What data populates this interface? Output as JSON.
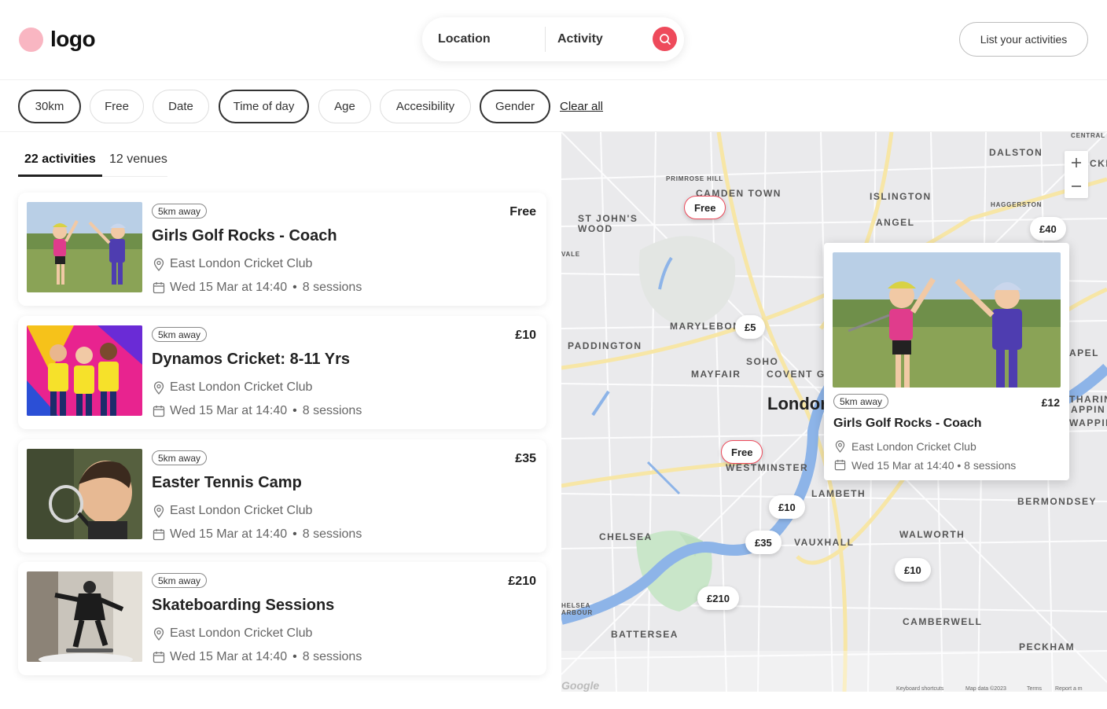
{
  "header": {
    "logo_text": "logo",
    "search": {
      "location": "Location",
      "activity": "Activity"
    },
    "list_button": "List your activities"
  },
  "filters": {
    "chips": [
      {
        "label": "30km",
        "active": true
      },
      {
        "label": "Free",
        "active": false
      },
      {
        "label": "Date",
        "active": false
      },
      {
        "label": "Time of day",
        "active": true
      },
      {
        "label": "Age",
        "active": false
      },
      {
        "label": "Accesibility",
        "active": false
      },
      {
        "label": "Gender",
        "active": true
      }
    ],
    "clear_all": "Clear all"
  },
  "tabs": [
    {
      "label": "22 activities",
      "selected": true
    },
    {
      "label": "12 venues",
      "selected": false
    }
  ],
  "activities": [
    {
      "title": "Girls Golf Rocks - Coach",
      "price": "Free",
      "distance": "5km away",
      "venue": "East London Cricket Club",
      "date": "Wed 15 Mar at 14:40",
      "sessions": "8 sessions"
    },
    {
      "title": "Dynamos Cricket: 8-11 Yrs",
      "price": "£10",
      "distance": "5km away",
      "venue": "East London Cricket Club",
      "date": "Wed 15 Mar at 14:40",
      "sessions": "8 sessions"
    },
    {
      "title": "Easter Tennis Camp",
      "price": "£35",
      "distance": "5km away",
      "venue": "East London Cricket Club",
      "date": "Wed 15 Mar at 14:40",
      "sessions": "8 sessions"
    },
    {
      "title": "Skateboarding Sessions",
      "price": "£210",
      "distance": "5km away",
      "venue": "East London Cricket Club",
      "date": "Wed 15 Mar at 14:40",
      "sessions": "8 sessions"
    }
  ],
  "map": {
    "labels": {
      "central": "CENTRAL",
      "dalston": "DALSTON",
      "primrose_hill": "PRIMROSE HILL",
      "camden_town": "CAMDEN TOWN",
      "islington": "ISLINGTON",
      "haggerston": "HAGGERSTON",
      "st_johns_wood": "ST JOHN'S WOOD",
      "angel": "ANGEL",
      "vale": "VALE",
      "marylebone": "MARYLEBON",
      "paddington": "PADDINGTON",
      "soho": "SOHO",
      "mayfair": "MAYFAIR",
      "covent_garden": "COVENT GA",
      "london": "Londor",
      "westminster": "WESTMINSTER",
      "lambeth": "LAMBETH",
      "bermondsey": "BERMONDSEY",
      "chelsea": "CHELSEA",
      "vauxhall": "VAUXHALL",
      "walworth": "WALWORTH",
      "chelsea_harbour": "HELSEA ARBOUR",
      "battersea": "BATTERSEA",
      "camberwell": "CAMBERWELL",
      "peckham": "PECKHAM",
      "cut_ckn": "CKN",
      "cut_apel": "APEL",
      "cut_tharin": "THARIN",
      "cut_appin": "APPIN",
      "cut_wappin": "WAPPIN"
    },
    "pins": {
      "free1": "Free",
      "free2": "Free",
      "p40": "£40",
      "p5": "£5",
      "p10a": "£10",
      "p35": "£35",
      "p210": "£210",
      "p10b": "£10"
    },
    "footer": {
      "google": "Google",
      "shortcuts": "Keyboard shortcuts",
      "mapdata": "Map data ©2023",
      "terms": "Terms",
      "report": "Report a m"
    },
    "popup": {
      "distance": "5km away",
      "price": "£12",
      "title": "Girls Golf Rocks - Coach",
      "venue": "East London Cricket Club",
      "date_sessions": "Wed 15 Mar at 14:40 • 8 sessions"
    }
  },
  "colors": {
    "accent": "#ee4a5b",
    "logo": "#f9b6c2",
    "water": "#8db4e8",
    "park": "#c9e6c9"
  }
}
